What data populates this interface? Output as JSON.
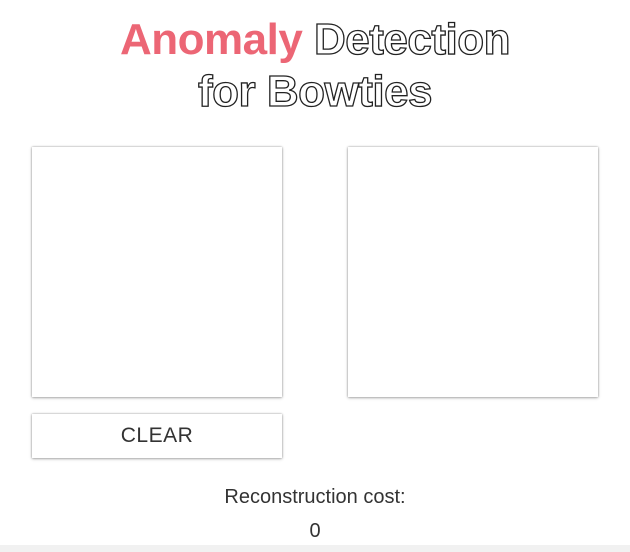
{
  "header": {
    "title_accent": "Anomaly",
    "title_line1_rest": "Detection",
    "title_line2": "for Bowties",
    "accent_color": "#ec6675"
  },
  "controls": {
    "clear_label": "CLEAR"
  },
  "result": {
    "cost_label": "Reconstruction cost:",
    "cost_value": "0"
  }
}
